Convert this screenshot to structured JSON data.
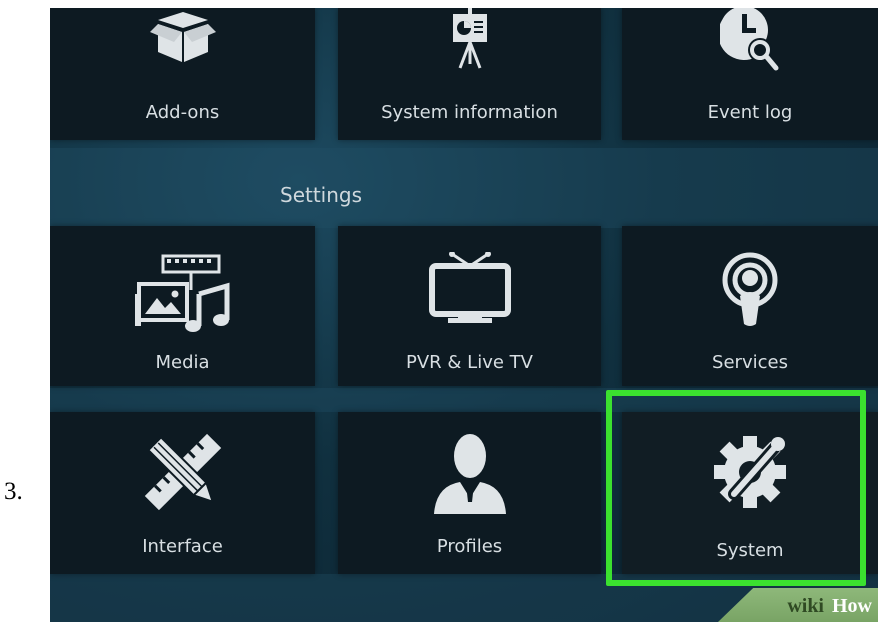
{
  "step": {
    "number": "3."
  },
  "top_row": [
    {
      "label": "Add-ons",
      "icon": "box-icon"
    },
    {
      "label": "System information",
      "icon": "presentation-board-icon"
    },
    {
      "label": "Event log",
      "icon": "clock-search-icon"
    }
  ],
  "section": {
    "title": "Settings"
  },
  "middle_row": [
    {
      "label": "Media",
      "icon": "media-icon"
    },
    {
      "label": "PVR & Live TV",
      "icon": "tv-icon"
    },
    {
      "label": "Services",
      "icon": "podcast-icon"
    }
  ],
  "bottom_row": [
    {
      "label": "Interface",
      "icon": "ruler-pencil-icon"
    },
    {
      "label": "Profiles",
      "icon": "user-icon"
    },
    {
      "label": "System",
      "icon": "gear-wrench-icon"
    }
  ],
  "watermark": {
    "wiki": "wiki",
    "how": "How"
  },
  "colors": {
    "highlight": "#3be12f",
    "tile": "#0d1a22",
    "background": "#10303f"
  }
}
